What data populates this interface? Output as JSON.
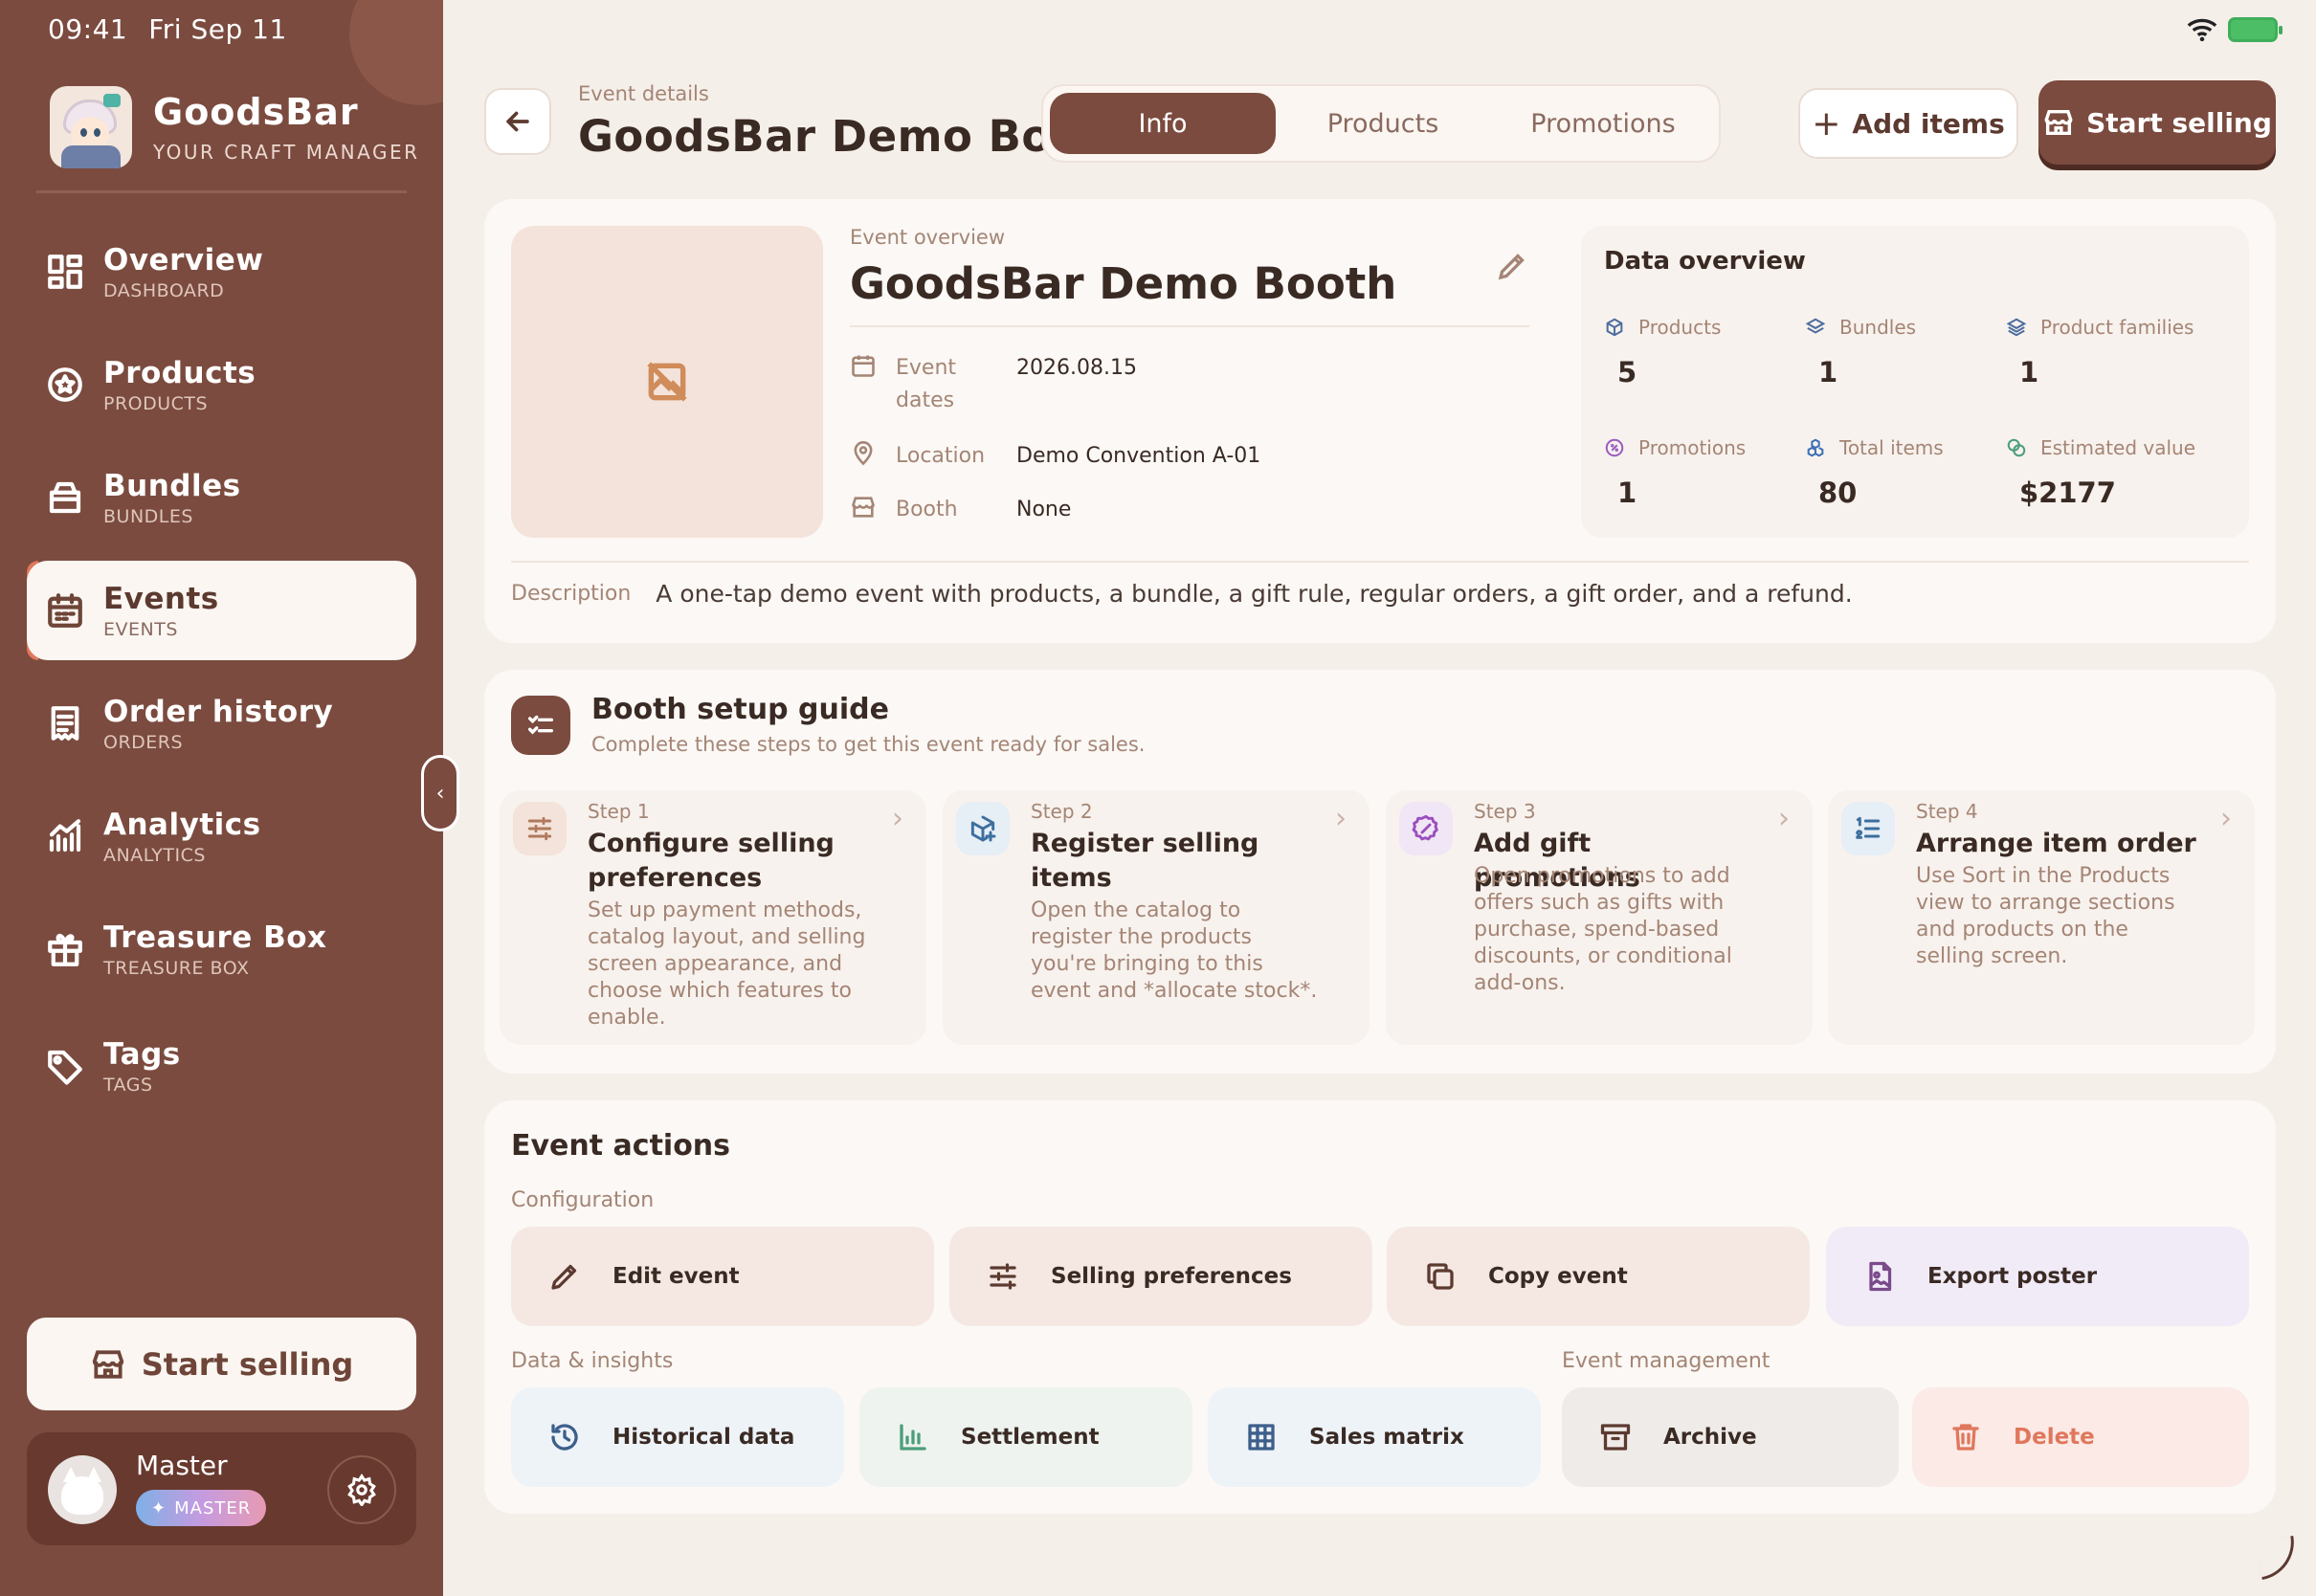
{
  "status": {
    "time": "09:41",
    "date": "Fri Sep 11"
  },
  "brand": {
    "name": "GoodsBar",
    "tagline": "YOUR CRAFT MANAGER"
  },
  "sidebar": {
    "items": [
      {
        "label": "Overview",
        "sub": "DASHBOARD",
        "icon": "grid-icon"
      },
      {
        "label": "Products",
        "sub": "PRODUCTS",
        "icon": "star-badge-icon"
      },
      {
        "label": "Bundles",
        "sub": "BUNDLES",
        "icon": "box-icon"
      },
      {
        "label": "Events",
        "sub": "EVENTS",
        "icon": "calendar-icon",
        "active": true
      },
      {
        "label": "Order history",
        "sub": "ORDERS",
        "icon": "receipt-icon"
      },
      {
        "label": "Analytics",
        "sub": "ANALYTICS",
        "icon": "chart-icon"
      },
      {
        "label": "Treasure Box",
        "sub": "TREASURE BOX",
        "icon": "gift-icon"
      },
      {
        "label": "Tags",
        "sub": "TAGS",
        "icon": "tag-icon"
      }
    ],
    "start_selling": "Start selling",
    "user": {
      "name": "Master",
      "badge": "MASTER"
    }
  },
  "header": {
    "breadcrumb": "Event details",
    "title": "GoodsBar Demo Booth",
    "tabs": [
      "Info",
      "Products",
      "Promotions"
    ],
    "active_tab": "Info",
    "add_items": "Add items",
    "start_selling": "Start selling"
  },
  "overview": {
    "label": "Event overview",
    "title": "GoodsBar Demo Booth",
    "fields": [
      {
        "label": "Event dates",
        "value": "2026.08.15"
      },
      {
        "label": "Location",
        "value": "Demo Convention A-01"
      },
      {
        "label": "Booth",
        "value": "None"
      }
    ],
    "description_label": "Description",
    "description": "A one-tap demo event with products, a bundle, a gift rule, regular orders, a gift order, and a refund."
  },
  "data_overview": {
    "title": "Data overview",
    "stats": [
      {
        "label": "Products",
        "value": "5"
      },
      {
        "label": "Bundles",
        "value": "1"
      },
      {
        "label": "Product families",
        "value": "1"
      },
      {
        "label": "Promotions",
        "value": "1"
      },
      {
        "label": "Total items",
        "value": "80"
      },
      {
        "label": "Estimated value",
        "value": "$2177"
      }
    ]
  },
  "guide": {
    "title": "Booth setup guide",
    "subtitle": "Complete these steps to get this event ready for sales.",
    "steps": [
      {
        "num": "Step 1",
        "title": "Configure selling preferences",
        "desc": "Set up payment methods, catalog layout, and selling screen appearance, and choose which features to enable."
      },
      {
        "num": "Step 2",
        "title": "Register selling items",
        "desc": "Open the catalog to register the products you're bringing to this event and *allocate stock*."
      },
      {
        "num": "Step 3",
        "title": "Add gift promotions",
        "desc": "Open promotions to add offers such as gifts with purchase, spend-based discounts, or conditional add-ons."
      },
      {
        "num": "Step 4",
        "title": "Arrange item order",
        "desc": "Use Sort in the Products view to arrange sections and products on the selling screen."
      }
    ]
  },
  "actions": {
    "title": "Event actions",
    "configuration_label": "Configuration",
    "configuration": [
      "Edit event",
      "Selling preferences",
      "Copy event",
      "Export poster"
    ],
    "insights_label": "Data & insights",
    "insights": [
      "Historical data",
      "Settlement",
      "Sales matrix"
    ],
    "management_label": "Event management",
    "management": [
      "Archive",
      "Delete"
    ]
  },
  "colors": {
    "accent": "#7b4b3f",
    "background": "#f5efea",
    "danger": "#e0775c"
  }
}
